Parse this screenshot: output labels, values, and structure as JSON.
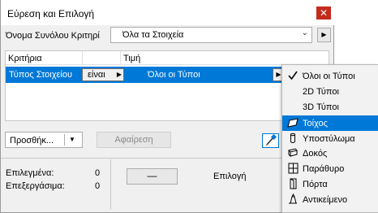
{
  "window": {
    "title": "Εύρεση και Επιλογή",
    "close_glyph": "✕"
  },
  "set_name": {
    "label": "Όνομα Συνόλου Κριτηρί",
    "value": "Όλα τα Στοιχεία",
    "chevron": "⌄",
    "side_arrow": "▶"
  },
  "criteria_list": {
    "headers": {
      "criteria": "Κριτήρια",
      "value": "Τιμή"
    },
    "row": {
      "criterion": "Τύπος Στοιχείου",
      "operator": "είναι",
      "operator_arrow": "▶",
      "value": "Όλοι οι Τύποι",
      "value_arrow": "▶"
    }
  },
  "buttons": {
    "add": "Προσθήκ...",
    "add_chevron": "▼",
    "remove": "Αφαίρεση",
    "minus": "—",
    "select": "Επιλογή"
  },
  "counts": {
    "selected_label": "Επιλεγμένα:",
    "selected_value": "0",
    "editable_label": "Επεξεργάσιμα:",
    "editable_value": "0"
  },
  "type_menu": {
    "items": [
      {
        "label": "Όλοι οι Τύποι",
        "icon": "checkmark-icon",
        "checked": true
      },
      {
        "label": "2D Τύποι",
        "icon": "",
        "checked": false
      },
      {
        "label": "3D Τύποι",
        "icon": "",
        "checked": false
      },
      {
        "label": "Τοίχος",
        "icon": "wall-icon",
        "highlighted": true
      },
      {
        "label": "Υποστύλωμα",
        "icon": "column-icon"
      },
      {
        "label": "Δοκός",
        "icon": "beam-icon"
      },
      {
        "label": "Παράθυρο",
        "icon": "window-icon"
      },
      {
        "label": "Πόρτα",
        "icon": "door-icon"
      },
      {
        "label": "Αντικείμενο",
        "icon": "object-icon"
      }
    ]
  },
  "colors": {
    "accent": "#0078d7",
    "close": "#c42b1c"
  }
}
